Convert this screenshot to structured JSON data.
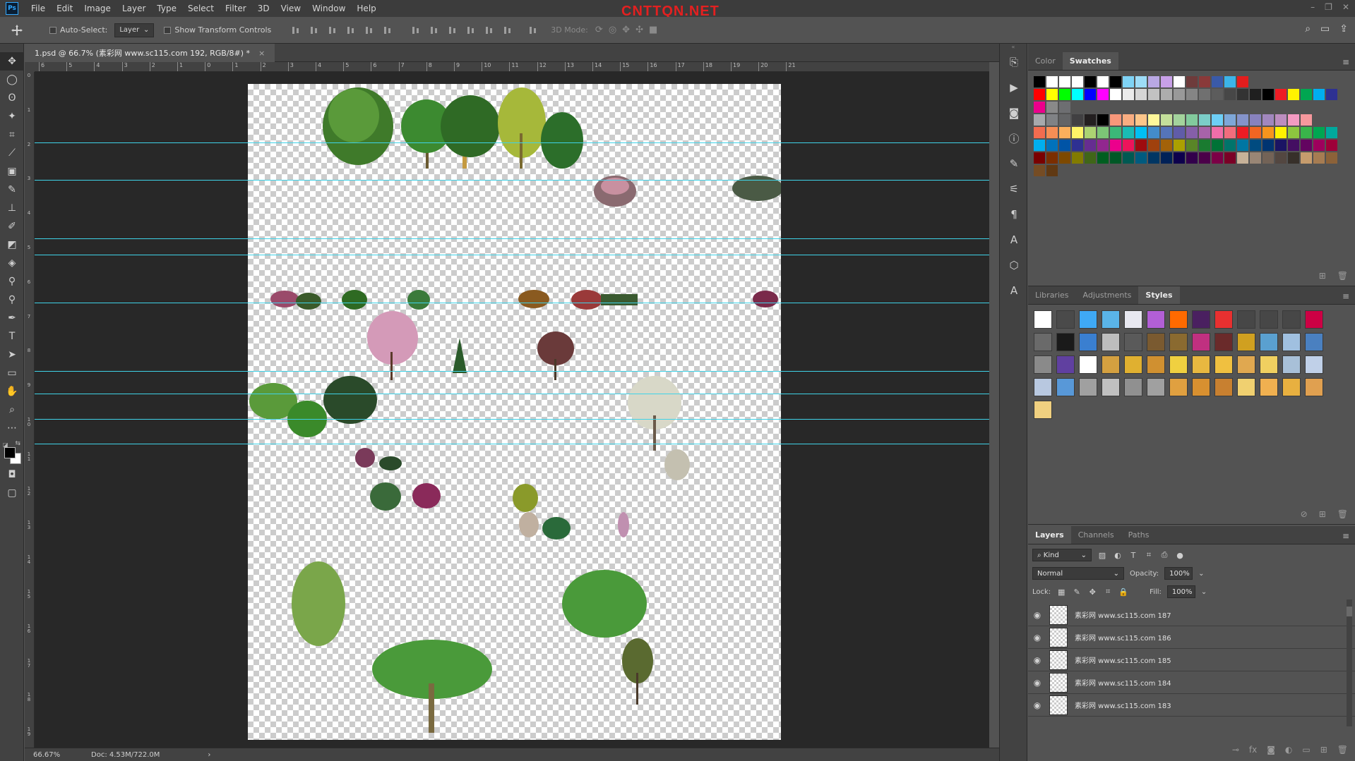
{
  "app": {
    "logo": "Ps",
    "watermark": "CNTTQN.NET",
    "menu": [
      "File",
      "Edit",
      "Image",
      "Layer",
      "Type",
      "Select",
      "Filter",
      "3D",
      "View",
      "Window",
      "Help"
    ],
    "window_controls": [
      "–",
      "❐",
      "✕"
    ]
  },
  "options": {
    "auto_select_label": "Auto-Select:",
    "auto_select_value": "Layer",
    "show_transform_label": "Show Transform Controls",
    "mode_3d_label": "3D Mode:"
  },
  "document": {
    "tab_title": "1.psd @ 66.7% (素彩网 www.sc115.com 192, RGB/8#) *",
    "close_glyph": "×"
  },
  "rulers": {
    "top_labels": [
      "6",
      "5",
      "4",
      "3",
      "2",
      "1",
      "0",
      "1",
      "2",
      "3",
      "4",
      "5",
      "6",
      "7",
      "8",
      "9",
      "10",
      "11",
      "12",
      "13",
      "14",
      "15",
      "16",
      "17",
      "18",
      "19",
      "20",
      "21"
    ],
    "left_labels": [
      "0",
      "1",
      "2",
      "3",
      "4",
      "5",
      "6",
      "7",
      "8",
      "9",
      "1 0",
      "1 1",
      "1 2",
      "1 3",
      "1 4",
      "1 5",
      "1 6",
      "1 7",
      "1 8",
      "1 9"
    ]
  },
  "status": {
    "zoom": "66.67%",
    "doc": "Doc: 4.53M/722.0M",
    "arrow": "›"
  },
  "color_panel": {
    "tabs": [
      "Color",
      "Swatches"
    ],
    "active": "Swatches",
    "swatch_rows": [
      [
        "#000000",
        "#ffffff",
        "#ffffff",
        "#ffffff",
        "#000000",
        "#ffffff",
        "#000000",
        "#7fd3f5",
        "#9ddcf7",
        "#b9a8e3",
        "#c8a0e8",
        "#ffffff",
        "#6e3b3b",
        "#8a3a3a",
        "#3a5aa8",
        "#3cb4e8",
        "#e31d1d"
      ],
      [
        "#ff0000",
        "#ffff00",
        "#00ff00",
        "#00ffff",
        "#0000ff",
        "#ff00ff",
        "#ffffff",
        "#ebebeb",
        "#d6d6d6",
        "#c2c2c2",
        "#adadad",
        "#999999",
        "#858585",
        "#707070",
        "#5c5c5c",
        "#474747",
        "#333333",
        "#1f1f1f",
        "#000000",
        "#ed1c24",
        "#fff200",
        "#00a651",
        "#00aeef",
        "#2e3192",
        "#ec008c",
        "#898989",
        "#6d6e71"
      ],
      [
        "#a7a9ac",
        "#808285",
        "#636466",
        "#414042",
        "#231f20",
        "#000000",
        "#f7977a",
        "#f9ad81",
        "#fdc68a",
        "#fff79a",
        "#c4df9b",
        "#a3d39c",
        "#82ca9d",
        "#7bcdc8",
        "#6ecff6",
        "#7ea7d8",
        "#8493ca",
        "#8882be",
        "#a187be",
        "#bc8dbf",
        "#f49ac2",
        "#f6989d"
      ],
      [
        "#f26c4f",
        "#f68e55",
        "#fbaf5c",
        "#fff467",
        "#acd372",
        "#7cc576",
        "#3bb878",
        "#1abbb4",
        "#00bff3",
        "#438ccb",
        "#5574b9",
        "#605ca8",
        "#855fa8",
        "#a763a8",
        "#f06ea9",
        "#f26d7d",
        "#ed1c24",
        "#f26522",
        "#f7941d",
        "#fff200",
        "#8dc63f",
        "#39b54a",
        "#00a651",
        "#00a99d"
      ],
      [
        "#00aeef",
        "#0072bc",
        "#0054a6",
        "#2e3192",
        "#662d91",
        "#92278f",
        "#ec008c",
        "#ed145b",
        "#9e0b0f",
        "#a0410d",
        "#a36209",
        "#aba000",
        "#598527",
        "#1a7b30",
        "#007236",
        "#00746b",
        "#0076a3",
        "#004b80",
        "#003471",
        "#1b1464",
        "#440e62",
        "#630460",
        "#9e005d",
        "#9e0039"
      ],
      [
        "#790000",
        "#7b2e00",
        "#7d4900",
        "#827b00",
        "#406618",
        "#005e20",
        "#005826",
        "#005952",
        "#005b7f",
        "#003663",
        "#002157",
        "#0d004c",
        "#32004b",
        "#4b0049",
        "#7b0046",
        "#7a0026",
        "#c7b299",
        "#998675",
        "#736357",
        "#534741",
        "#37302a",
        "#c69c6d",
        "#a67c52",
        "#8c6239"
      ],
      [
        "#754c24",
        "#603913"
      ]
    ]
  },
  "styles_panel": {
    "tabs": [
      "Libraries",
      "Adjustments",
      "Styles"
    ],
    "active": "Styles",
    "style_colors": [
      "#ffffff",
      "#4a4a4a",
      "#3fa9f5",
      "#5ab4e8",
      "#e8e8f0",
      "#b25fd6",
      "#ff6a00",
      "#4a2060",
      "#e83030",
      "#474747",
      "#474747",
      "#474747",
      "#cc0044",
      "#6a6a6a",
      "#1a1a1a",
      "#3a7fd0",
      "#bdbdbd",
      "#5a5a5a",
      "#7a5a30",
      "#8a6a30",
      "#c03080",
      "#6a2a2a",
      "#d0a020",
      "#5aa0d0",
      "#a0c0e0",
      "#4a80c0",
      "#8a8a8a",
      "#6040a0",
      "#ffffff",
      "#d4a040",
      "#e0b030",
      "#d09030",
      "#f0d040",
      "#e8b840",
      "#f0c040",
      "#e0a850",
      "#f0d060",
      "#a8c0d8",
      "#c0d0e8",
      "#b8c8e0",
      "#5898d8",
      "#a0a0a0",
      "#c0c0c0",
      "#909090",
      "#a0a0a0",
      "#e0a040",
      "#d89030",
      "#c88030",
      "#f0d070",
      "#f0b050",
      "#e8b040",
      "#e0a050",
      "#f0d080"
    ]
  },
  "layers_panel": {
    "tabs": [
      "Layers",
      "Channels",
      "Paths"
    ],
    "active": "Layers",
    "filter_label": "Kind",
    "blend_mode": "Normal",
    "opacity_label": "Opacity:",
    "opacity_value": "100%",
    "lock_label": "Lock:",
    "fill_label": "Fill:",
    "fill_value": "100%",
    "layers": [
      {
        "name": "素彩网 www.sc115.com 187"
      },
      {
        "name": "素彩网 www.sc115.com 186"
      },
      {
        "name": "素彩网 www.sc115.com 185"
      },
      {
        "name": "素彩网 www.sc115.com 184"
      },
      {
        "name": "素彩网 www.sc115.com 183"
      }
    ]
  }
}
